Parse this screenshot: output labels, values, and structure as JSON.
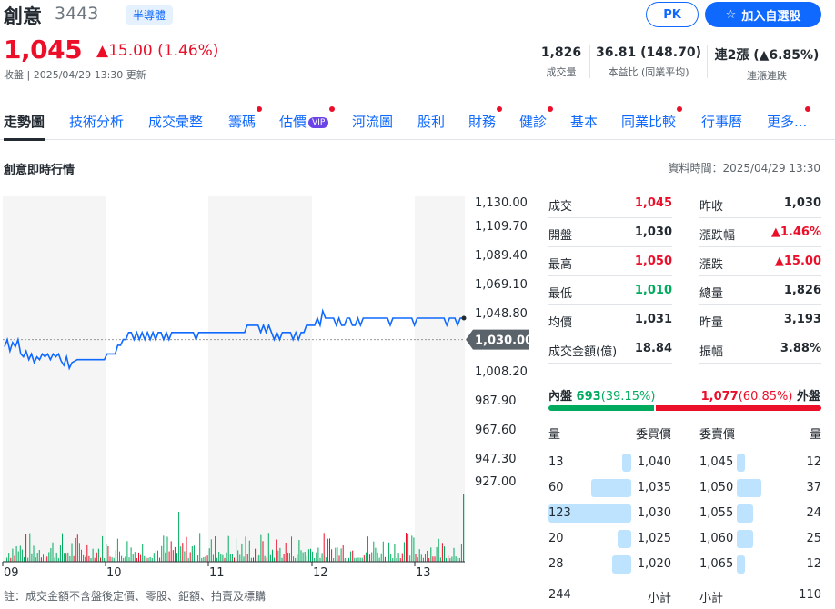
{
  "header": {
    "name": "創意",
    "code": "3443",
    "industry": "半導體",
    "price": "1,045",
    "change": "15.00 (1.46%)",
    "close_info": "收盤 | 2025/04/29 13:30 更新",
    "pk_label": "PK",
    "watch_label": "加入自選股",
    "stats": [
      {
        "value": "1,826",
        "label": "成交量"
      },
      {
        "value": "36.81 (148.70)",
        "label": "本益比 (同業平均)"
      },
      {
        "value_prefix": "連2漲 (",
        "value_up": "6.85%",
        "value_suffix": ")",
        "label": "連漲連跌"
      }
    ]
  },
  "tabs": [
    {
      "label": "走勢圖",
      "dot": false,
      "active": true
    },
    {
      "label": "技術分析",
      "dot": false
    },
    {
      "label": "成交彙整",
      "dot": false
    },
    {
      "label": "籌碼",
      "dot": true
    },
    {
      "label": "估價",
      "dot": true,
      "vip": "VIP"
    },
    {
      "label": "河流圖",
      "dot": false
    },
    {
      "label": "股利",
      "dot": false
    },
    {
      "label": "財務",
      "dot": true
    },
    {
      "label": "健診",
      "dot": true
    },
    {
      "label": "基本",
      "dot": false
    },
    {
      "label": "同業比較",
      "dot": true
    },
    {
      "label": "行事曆",
      "dot": false
    },
    {
      "label": "更多...",
      "dot": true
    }
  ],
  "section_title": "創意即時行情",
  "data_time": "資料時間：2025/04/29 13:30",
  "chart_data": {
    "type": "line",
    "y_ticks": [
      "1,130.00",
      "1,109.70",
      "1,089.40",
      "1,069.10",
      "1,048.80",
      "1,030.00",
      "1,008.20",
      "987.90",
      "967.60",
      "947.30",
      "927.00"
    ],
    "reference_price": "1,030.00",
    "x_ticks": [
      "09",
      "10",
      "11",
      "12",
      "13"
    ],
    "ylim": [
      927,
      1130
    ],
    "price_series": [
      1025,
      1030,
      1022,
      1028,
      1025,
      1030,
      1020,
      1018,
      1022,
      1016,
      1020,
      1014,
      1018,
      1016,
      1020,
      1018,
      1020,
      1016,
      1020,
      1018,
      1020,
      1015,
      1012,
      1018,
      1010,
      1014,
      1015,
      1016,
      1016,
      1016,
      1016,
      1016,
      1016,
      1016,
      1016,
      1016,
      1016,
      1016,
      1020,
      1020,
      1020,
      1020,
      1026,
      1026,
      1030,
      1030,
      1035,
      1035,
      1030,
      1035,
      1030,
      1035,
      1030,
      1035,
      1030,
      1035,
      1030,
      1035,
      1035,
      1030,
      1035,
      1030,
      1035,
      1035,
      1035,
      1035,
      1035,
      1035,
      1035,
      1035,
      1035,
      1030,
      1035,
      1035,
      1035,
      1035,
      1035,
      1035,
      1035,
      1035,
      1035,
      1035,
      1035,
      1035,
      1035,
      1035,
      1035,
      1035,
      1035,
      1035,
      1040,
      1040,
      1040,
      1040,
      1040,
      1035,
      1040,
      1035,
      1040,
      1035,
      1030,
      1035,
      1030,
      1035,
      1035,
      1035,
      1035,
      1030,
      1035,
      1030,
      1035,
      1035,
      1040,
      1040,
      1040,
      1040,
      1045,
      1040,
      1050,
      1045,
      1045,
      1045,
      1045,
      1040,
      1045,
      1040,
      1040,
      1045,
      1045,
      1040,
      1040,
      1045,
      1040,
      1045,
      1045,
      1045,
      1045,
      1045,
      1045,
      1045,
      1045,
      1045,
      1045,
      1040,
      1045,
      1045,
      1045,
      1045,
      1045,
      1045,
      1045,
      1045,
      1040,
      1045,
      1045,
      1045,
      1045,
      1045,
      1045,
      1045,
      1045,
      1045,
      1045,
      1045,
      1040,
      1045,
      1045,
      1045,
      1040,
      1045,
      1045
    ],
    "volume_note": "per-minute volume bars (red=up, green=down)"
  },
  "quote": {
    "left": [
      {
        "label": "成交",
        "value": "1,045",
        "cls": "up"
      },
      {
        "label": "開盤",
        "value": "1,030",
        "cls": "flat"
      },
      {
        "label": "最高",
        "value": "1,050",
        "cls": "up"
      },
      {
        "label": "最低",
        "value": "1,010",
        "cls": "down"
      },
      {
        "label": "均價",
        "value": "1,031",
        "cls": "flat"
      },
      {
        "label": "成交金額(億)",
        "value": "18.84",
        "cls": "flat"
      }
    ],
    "right": [
      {
        "label": "昨收",
        "value": "1,030",
        "cls": "flat"
      },
      {
        "label": "漲跌幅",
        "value": "▲1.46%",
        "cls": "up"
      },
      {
        "label": "漲跌",
        "value": "▲15.00",
        "cls": "up"
      },
      {
        "label": "總量",
        "value": "1,826",
        "cls": "flat"
      },
      {
        "label": "昨量",
        "value": "3,193",
        "cls": "flat"
      },
      {
        "label": "振幅",
        "value": "3.88%",
        "cls": "flat"
      }
    ]
  },
  "inout": {
    "inner_label": "內盤",
    "inner_value": "693",
    "inner_pct": "(39.15%)",
    "outer_value": "1,077",
    "outer_pct": "(60.85%)",
    "outer_label": "外盤",
    "inner_fraction": 0.3915
  },
  "orderbook": {
    "head_bid_qty": "量",
    "head_bid_price": "委買價",
    "head_ask_price": "委賣價",
    "head_ask_qty": "量",
    "bids": [
      {
        "qty": "13",
        "price": "1,040",
        "level": 13
      },
      {
        "qty": "60",
        "price": "1,035",
        "level": 60
      },
      {
        "qty": "123",
        "price": "1,030",
        "level": 123
      },
      {
        "qty": "20",
        "price": "1,025",
        "level": 20
      },
      {
        "qty": "28",
        "price": "1,020",
        "level": 28
      }
    ],
    "asks": [
      {
        "price": "1,045",
        "qty": "12",
        "level": 12
      },
      {
        "price": "1,050",
        "qty": "37",
        "level": 37
      },
      {
        "price": "1,055",
        "qty": "24",
        "level": 24
      },
      {
        "price": "1,060",
        "qty": "25",
        "level": 25
      },
      {
        "price": "1,065",
        "qty": "12",
        "level": 12
      }
    ],
    "bid_total": "244",
    "subtotal_label": "小計",
    "ask_subtotal_label": "小計",
    "ask_total": "110"
  },
  "footnote": "註：成交金額不含盤後定價、零股、鉅額、拍賣及標購",
  "colors": {
    "up": "#eb0f29",
    "down": "#00ab5e",
    "accent": "#0f69ff",
    "line": "#0f69ff",
    "bar_bid": "#bde3ff"
  }
}
